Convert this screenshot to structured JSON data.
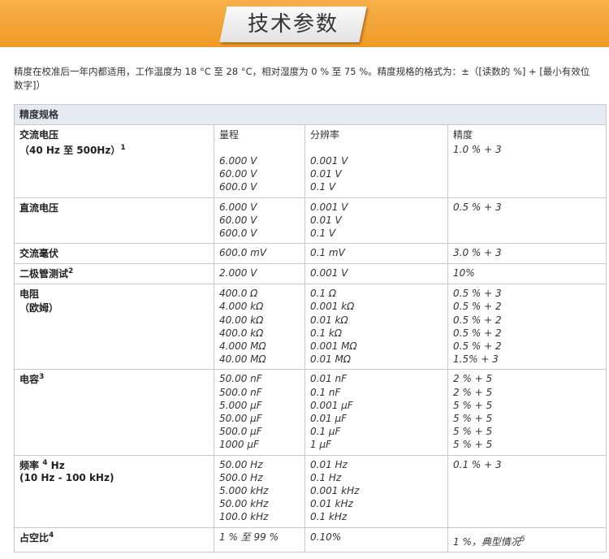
{
  "header": {
    "title": "技术参数"
  },
  "intro": "精度在校准后一年内都适用，工作温度为 18 °C 至 28 °C，相对湿度为 0 % 至 75 %。精度规格的格式为：±（[读数的 %] + [最小有效位数字]）",
  "table": {
    "section_title": "精度规格",
    "col_range": "量程",
    "col_resolution": "分辨率",
    "col_accuracy": "精度",
    "ac_voltage": {
      "label": "交流电压",
      "sublabel": "（40 Hz 至 500Hz）",
      "footnote": "1",
      "ranges": [
        "6.000 V",
        "60.00 V",
        "600.0 V"
      ],
      "resolutions": [
        "0.001 V",
        "0.01 V",
        "0.1 V"
      ],
      "accuracy": [
        "1.0 % + 3"
      ]
    },
    "dc_voltage": {
      "label": "直流电压",
      "ranges": [
        "6.000 V",
        "60.00 V",
        "600.0 V"
      ],
      "resolutions": [
        "0.001 V",
        "0.01 V",
        "0.1 V"
      ],
      "accuracy": [
        "0.5 % + 3"
      ]
    },
    "ac_mv": {
      "label": "交流毫伏",
      "ranges": [
        "600.0 mV"
      ],
      "resolutions": [
        "0.1 mV"
      ],
      "accuracy": [
        "3.0 % + 3"
      ]
    },
    "diode": {
      "label": "二极管测试",
      "footnote": "2",
      "ranges": [
        "2.000 V"
      ],
      "resolutions": [
        "0.001 V"
      ],
      "accuracy": [
        "10%"
      ]
    },
    "resistance": {
      "label": "电阻",
      "sublabel": "（欧姆）",
      "ranges": [
        "400.0 Ω",
        "4.000 kΩ",
        "40.00 kΩ",
        "400.0 kΩ",
        "4.000 MΩ",
        "40.00 MΩ"
      ],
      "resolutions": [
        "0.1 Ω",
        "0.001 kΩ",
        "0.01 kΩ",
        "0.1 kΩ",
        "0.001 MΩ",
        "0.01 MΩ"
      ],
      "accuracy": [
        "0.5 % + 3",
        "0.5 % + 2",
        "0.5 % + 2",
        "0.5 % + 2",
        "0.5 % + 2",
        "1.5% + 3"
      ]
    },
    "capacitance": {
      "label": "电容",
      "footnote": "3",
      "ranges": [
        "50.00 nF",
        "500.0 nF",
        "5.000 µF",
        "50.00 µF",
        "500.0 µF",
        "1000 µF"
      ],
      "resolutions": [
        "0.01 nF",
        "0.1 nF",
        "0.001 µF",
        "0.01 µF",
        "0.1 µF",
        "1 µF"
      ],
      "accuracy": [
        "2 % + 5",
        "2 % + 5",
        "5 % + 5",
        "5 % + 5",
        "5 % + 5",
        "5 % + 5"
      ]
    },
    "frequency": {
      "label": "频率",
      "footnote": "4",
      "unit": "Hz",
      "sublabel": "(10 Hz - 100 kHz)",
      "ranges": [
        "50.00 Hz",
        "500.0 Hz",
        "5.000 kHz",
        "50.00 kHz",
        "100.0 kHz"
      ],
      "resolutions": [
        "0.01 Hz",
        "0.1 Hz",
        "0.001 kHz",
        "0.01 kHz",
        "0.1 kHz"
      ],
      "accuracy": [
        "0.1 % + 3"
      ]
    },
    "duty_cycle": {
      "label": "占空比",
      "footnote": "4",
      "range": "1 % 至 99 %",
      "resolution": "0.10%",
      "accuracy": "1 %，典型情况",
      "accuracy_footnote": "5"
    }
  }
}
